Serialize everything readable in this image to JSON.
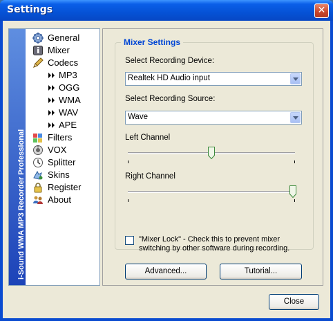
{
  "window": {
    "title": "Settings",
    "close_glyph": "✕"
  },
  "sidebar": {
    "banner": "i-Sound WMA MP3 Recorder Professional",
    "items": [
      {
        "label": "General",
        "icon": "gear-icon"
      },
      {
        "label": "Mixer",
        "icon": "info-icon"
      },
      {
        "label": "Codecs",
        "icon": "pencil-icon"
      },
      {
        "label": "MP3",
        "icon": "double-arrow-icon"
      },
      {
        "label": "OGG",
        "icon": "double-arrow-icon"
      },
      {
        "label": "WMA",
        "icon": "double-arrow-icon"
      },
      {
        "label": "WAV",
        "icon": "double-arrow-icon"
      },
      {
        "label": "APE",
        "icon": "double-arrow-icon"
      },
      {
        "label": "Filters",
        "icon": "filters-icon"
      },
      {
        "label": "VOX",
        "icon": "vox-icon"
      },
      {
        "label": "Splitter",
        "icon": "clock-icon"
      },
      {
        "label": "Skins",
        "icon": "skins-icon"
      },
      {
        "label": "Register",
        "icon": "lock-icon"
      },
      {
        "label": "About",
        "icon": "users-icon"
      }
    ]
  },
  "mixer": {
    "group_title": "Mixer Settings",
    "device_label": "Select Recording Device:",
    "device_value": "Realtek HD Audio input",
    "source_label": "Select Recording Source:",
    "source_value": "Wave",
    "left_label": "Left Channel",
    "left_level": 0.5,
    "right_label": "Right Channel",
    "right_level": 1.0,
    "mixer_lock_text": "\"Mixer Lock\" - Check this to prevent mixer switching by other software during recording.",
    "mixer_lock_checked": false,
    "advanced_label": "Advanced...",
    "tutorial_label": "Tutorial..."
  },
  "footer": {
    "close_label": "Close"
  },
  "colors": {
    "title_bar": "#0552d6",
    "accent": "#0046d5",
    "face": "#ece9d8"
  }
}
